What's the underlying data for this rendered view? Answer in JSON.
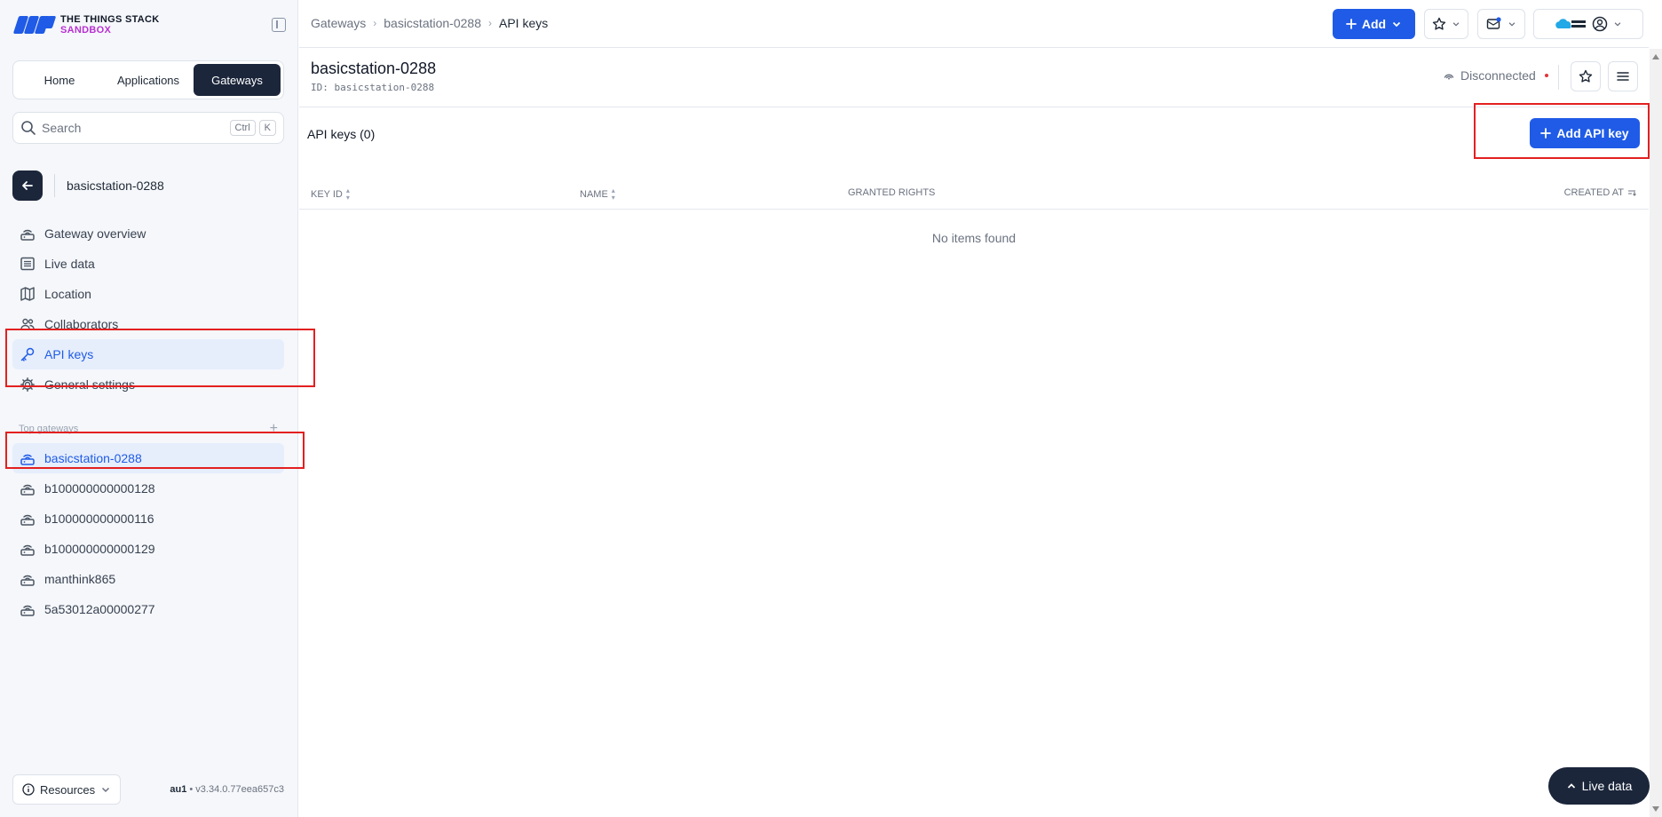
{
  "brand": {
    "line1": "THE THINGS STACK",
    "line2": "SANDBOX",
    "accent": "#1f5be6",
    "sandbox_color": "#b82fd1"
  },
  "switcher": {
    "items": [
      "Home",
      "Applications",
      "Gateways"
    ],
    "active": "Gateways"
  },
  "search": {
    "placeholder": "Search",
    "kbd1": "Ctrl",
    "kbd2": "K"
  },
  "entity": {
    "name": "basicstation-0288"
  },
  "nav": {
    "items": [
      {
        "label": "Gateway overview",
        "icon": "gateway-icon"
      },
      {
        "label": "Live data",
        "icon": "list-icon"
      },
      {
        "label": "Location",
        "icon": "map-icon"
      },
      {
        "label": "Collaborators",
        "icon": "people-icon"
      },
      {
        "label": "API keys",
        "icon": "key-icon",
        "active": true
      },
      {
        "label": "General settings",
        "icon": "gear-icon"
      }
    ]
  },
  "top_gateways": {
    "heading": "Top gateways",
    "items": [
      "basicstation-0288",
      "b100000000000128",
      "b100000000000116",
      "b100000000000129",
      "manthink865",
      "5a53012a00000277"
    ]
  },
  "footer": {
    "resources": "Resources",
    "region": "au1",
    "version": "v3.34.0.77eea657c3"
  },
  "topbar": {
    "breadcrumbs": [
      "Gateways",
      "basicstation-0288",
      "API keys"
    ],
    "add_label": "Add"
  },
  "gateway_header": {
    "title": "basicstation-0288",
    "id_prefix": "ID:",
    "id": "basicstation-0288",
    "status": "Disconnected",
    "status_color": "#e5323b"
  },
  "content": {
    "title": "API keys (0)",
    "add_button": "Add API key",
    "columns": [
      "KEY ID",
      "NAME",
      "GRANTED RIGHTS",
      "CREATED AT"
    ],
    "empty_text": "No items found"
  },
  "live_data_button": "Live data"
}
